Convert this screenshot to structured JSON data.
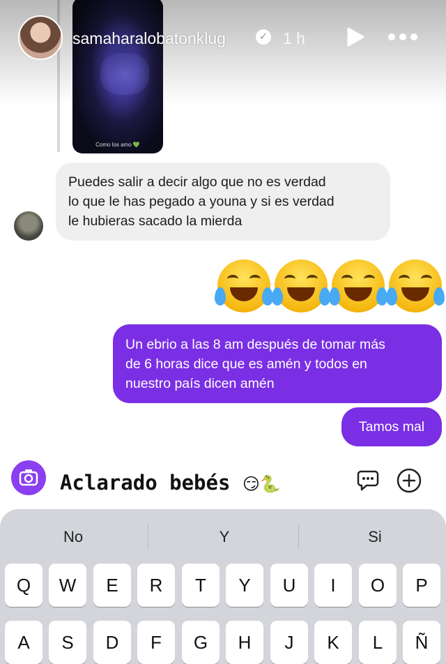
{
  "header": {
    "username": "samaharalobatonklug",
    "verified_mark": "✓",
    "time": "1 h",
    "icons": [
      "play-icon",
      "more-icon"
    ]
  },
  "shared_video": {
    "caption": "Como los amo 💚"
  },
  "messages": {
    "received": {
      "lines": [
        "Puedes salir a decir algo que no es verdad",
        "lo que le has pegado a youna y si es verdad",
        "le hubieras sacado la mierda"
      ]
    },
    "emojis": [
      "😂",
      "😂",
      "😂",
      "😂"
    ],
    "sent": [
      {
        "lines": [
          "Un ebrio a las 8 am después de tomar más",
          "de 6 horas dice que es amén y todos en",
          "nuestro país dicen amén"
        ]
      },
      {
        "text": "Tamos mal"
      }
    ]
  },
  "composer": {
    "text": "Aclarado bebés",
    "emojis": "😏🐍",
    "icons": [
      "camera-icon",
      "chat-icon",
      "add-icon"
    ]
  },
  "keyboard": {
    "suggestions": [
      "No",
      "Y",
      "Si"
    ],
    "row1": [
      "Q",
      "W",
      "E",
      "R",
      "T",
      "Y",
      "U",
      "I",
      "O",
      "P"
    ],
    "row2": [
      "A",
      "S",
      "D",
      "F",
      "G",
      "H",
      "J",
      "K",
      "L",
      "Ñ"
    ]
  },
  "colors": {
    "sent_bubble": "#7a2fe4",
    "received_bubble": "#efefef",
    "camera_button": "#8a3ff0",
    "keyboard_bg": "#d3d5db"
  }
}
